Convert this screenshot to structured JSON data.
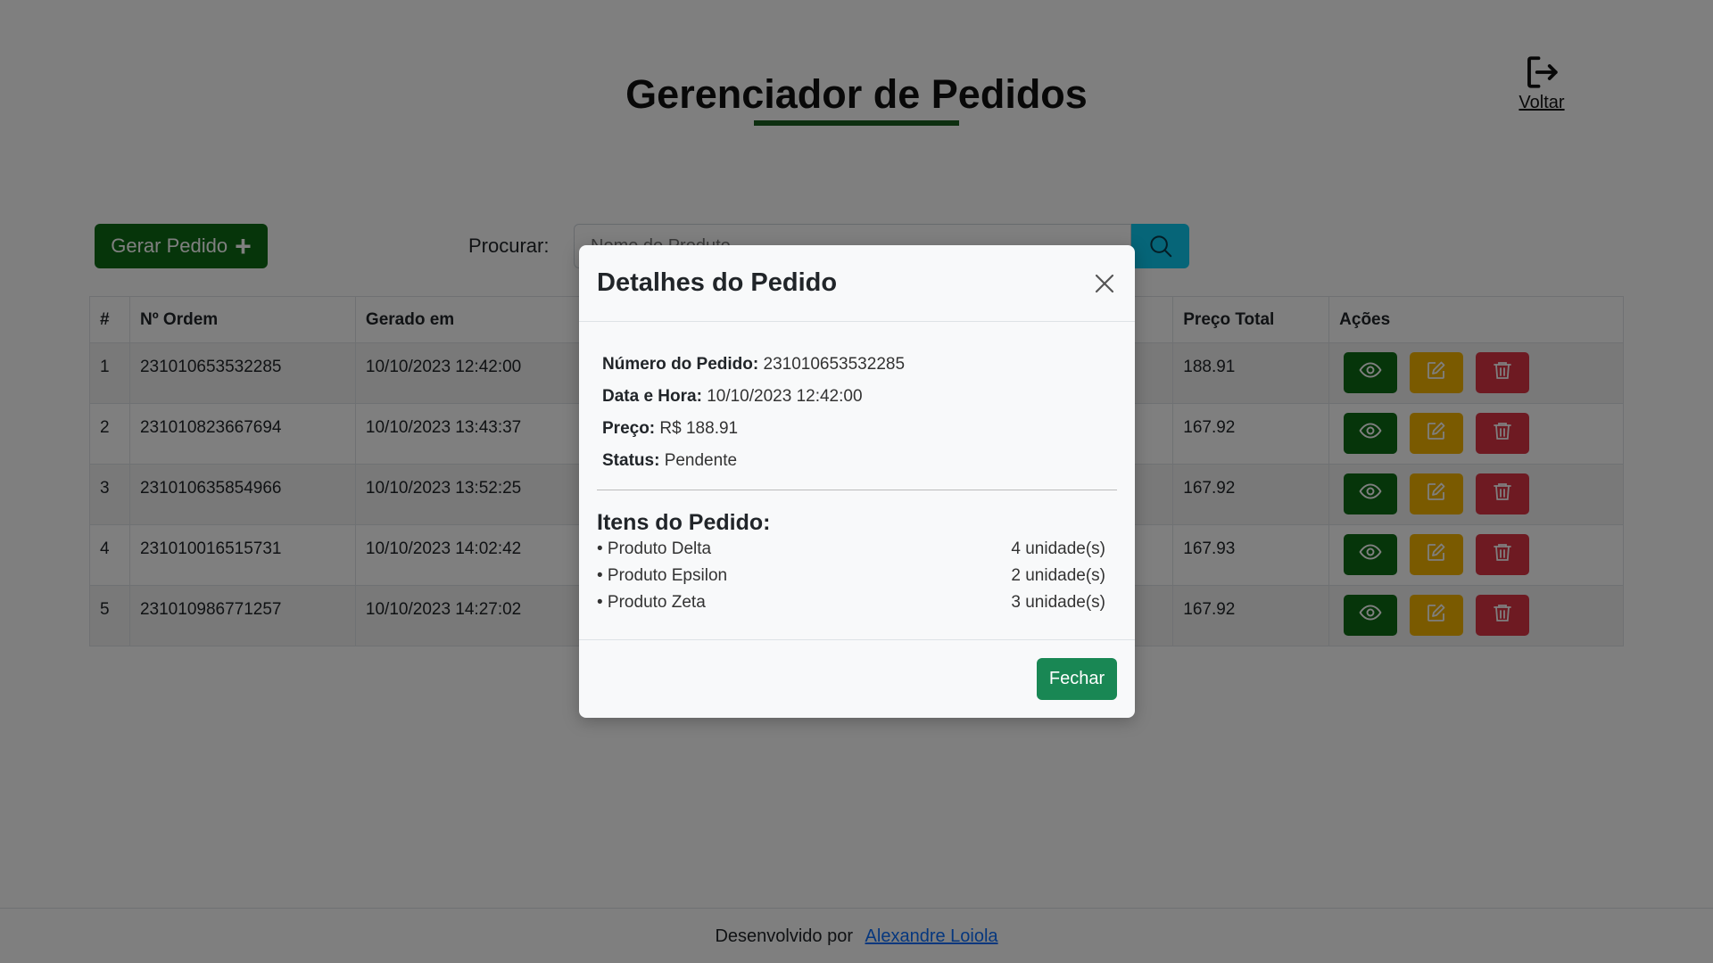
{
  "header": {
    "title": "Gerenciador de Pedidos",
    "back_label": "Voltar"
  },
  "toolbar": {
    "generate_label": "Gerar Pedido",
    "search_label": "Procurar:",
    "search_placeholder": "Nome do Produto"
  },
  "table": {
    "headers": [
      "#",
      "Nº Ordem",
      "Gerado em",
      "",
      "Preço Total",
      "Ações"
    ],
    "rows": [
      {
        "idx": "1",
        "ordem": "231010653532285",
        "gerado": "10/10/2023 12:42:00",
        "preco": "188.91"
      },
      {
        "idx": "2",
        "ordem": "231010823667694",
        "gerado": "10/10/2023 13:43:37",
        "preco": "167.92"
      },
      {
        "idx": "3",
        "ordem": "231010635854966",
        "gerado": "10/10/2023 13:52:25",
        "preco": "167.92"
      },
      {
        "idx": "4",
        "ordem": "231010016515731",
        "gerado": "10/10/2023 14:02:42",
        "preco": "167.93"
      },
      {
        "idx": "5",
        "ordem": "231010986771257",
        "gerado": "10/10/2023 14:27:02",
        "preco": "167.92"
      }
    ]
  },
  "footer": {
    "text": "Desenvolvido por",
    "link": "Alexandre Loiola"
  },
  "modal": {
    "title": "Detalhes do Pedido",
    "details": [
      {
        "label": "Número do Pedido:",
        "value": "231010653532285"
      },
      {
        "label": "Data e Hora:",
        "value": "10/10/2023 12:42:00"
      },
      {
        "label": "Preço:",
        "value": "R$ 188.91"
      },
      {
        "label": "Status:",
        "value": "Pendente"
      }
    ],
    "items_title": "Itens do Pedido:",
    "items": [
      {
        "name": "• Produto Delta",
        "qty": "4 unidade(s)"
      },
      {
        "name": "• Produto Epsilon",
        "qty": "2 unidade(s)"
      },
      {
        "name": "• Produto Zeta",
        "qty": "3 unidade(s)"
      }
    ],
    "close_label": "Fechar"
  },
  "colors": {
    "primary_green": "#0c6b14",
    "warning": "#f5b400",
    "danger": "#dc3545",
    "info": "#0dcaf0",
    "success": "#198754"
  },
  "icons": [
    "logout-icon",
    "plus-icon",
    "search-icon",
    "eye-icon",
    "edit-icon",
    "trash-icon",
    "close-icon"
  ]
}
